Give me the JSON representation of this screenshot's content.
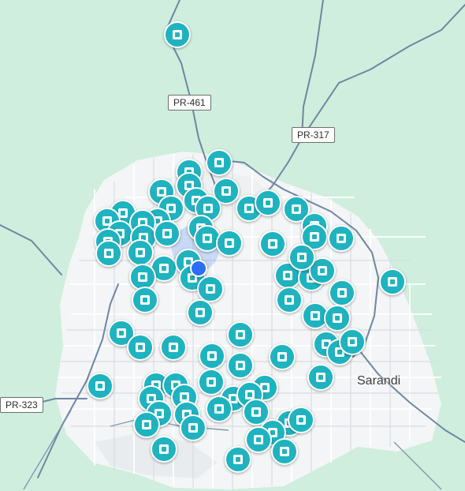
{
  "map": {
    "road_labels": {
      "pr461": "PR-461",
      "pr317": "PR-317",
      "pr323": "PR-323"
    },
    "place_labels": {
      "sarandi": "Sarandi"
    },
    "colors": {
      "background": "#cfeedd",
      "urban_area": "#f4f5f6",
      "road": "#6f86a3",
      "marker": "#1fb3bf",
      "location": "#2d6df6"
    },
    "icons": {
      "marker": "station-icon",
      "location": "current-location-dot"
    }
  }
}
